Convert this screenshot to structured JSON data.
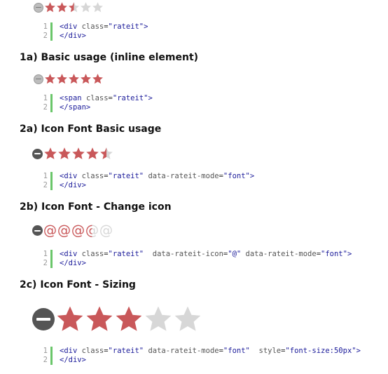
{
  "colors": {
    "filled": "#c9585a",
    "empty": "#d7d7d7",
    "accent_bar": "#6ac66a"
  },
  "sections": [
    {
      "id": "0",
      "title": "",
      "rating": {
        "mode": "image",
        "value": 2.5,
        "max": 5
      },
      "code": [
        [
          {
            "t": "tag",
            "v": "<div "
          },
          {
            "t": "attr",
            "v": "class"
          },
          {
            "t": "eq",
            "v": "="
          },
          {
            "t": "str",
            "v": "\"rateit\""
          },
          {
            "t": "tag",
            "v": ">"
          }
        ],
        [
          {
            "t": "tag",
            "v": "</div>"
          }
        ]
      ]
    },
    {
      "id": "1a",
      "title": "1a) Basic usage (inline element)",
      "rating": {
        "mode": "image",
        "value": 5,
        "max": 5
      },
      "code": [
        [
          {
            "t": "tag",
            "v": "<span "
          },
          {
            "t": "attr",
            "v": "class"
          },
          {
            "t": "eq",
            "v": "="
          },
          {
            "t": "str",
            "v": "\"rateit\""
          },
          {
            "t": "tag",
            "v": ">"
          }
        ],
        [
          {
            "t": "tag",
            "v": "</span>"
          }
        ]
      ]
    },
    {
      "id": "2a",
      "title": "2a) Icon Font Basic usage",
      "rating": {
        "mode": "font",
        "value": 4.5,
        "max": 5
      },
      "code": [
        [
          {
            "t": "tag",
            "v": "<div "
          },
          {
            "t": "attr",
            "v": "class"
          },
          {
            "t": "eq",
            "v": "="
          },
          {
            "t": "str",
            "v": "\"rateit\""
          },
          {
            "t": "attr",
            "v": " data-rateit-mode"
          },
          {
            "t": "eq",
            "v": "="
          },
          {
            "t": "str",
            "v": "\"font\""
          },
          {
            "t": "tag",
            "v": ">"
          }
        ],
        [
          {
            "t": "tag",
            "v": "</div>"
          }
        ]
      ]
    },
    {
      "id": "2b",
      "title": "2b) Icon Font - Change icon",
      "rating": {
        "mode": "icon",
        "icon": "@",
        "value": 3.5,
        "max": 5
      },
      "code": [
        [
          {
            "t": "tag",
            "v": "<div "
          },
          {
            "t": "attr",
            "v": "class"
          },
          {
            "t": "eq",
            "v": "="
          },
          {
            "t": "str",
            "v": "\"rateit\""
          },
          {
            "t": "attr",
            "v": "  data-rateit-icon"
          },
          {
            "t": "eq",
            "v": "="
          },
          {
            "t": "str",
            "v": "\"@\""
          },
          {
            "t": "attr",
            "v": " data-rateit-mode"
          },
          {
            "t": "eq",
            "v": "="
          },
          {
            "t": "str",
            "v": "\"font\""
          },
          {
            "t": "tag",
            "v": ">"
          }
        ],
        [
          {
            "t": "tag",
            "v": "</div>"
          }
        ]
      ]
    },
    {
      "id": "2c",
      "title": "2c) Icon Font - Sizing",
      "rating": {
        "mode": "font-large",
        "value": 3,
        "max": 5
      },
      "code": [
        [
          {
            "t": "tag",
            "v": "<div "
          },
          {
            "t": "attr",
            "v": "class"
          },
          {
            "t": "eq",
            "v": "="
          },
          {
            "t": "str",
            "v": "\"rateit\""
          },
          {
            "t": "attr",
            "v": " data-rateit-mode"
          },
          {
            "t": "eq",
            "v": "="
          },
          {
            "t": "str",
            "v": "\"font\""
          },
          {
            "t": "attr",
            "v": "  style"
          },
          {
            "t": "eq",
            "v": "="
          },
          {
            "t": "str",
            "v": "\"font-size:50px\""
          },
          {
            "t": "tag",
            "v": ">"
          }
        ],
        [
          {
            "t": "tag",
            "v": "</div>"
          }
        ]
      ]
    }
  ]
}
